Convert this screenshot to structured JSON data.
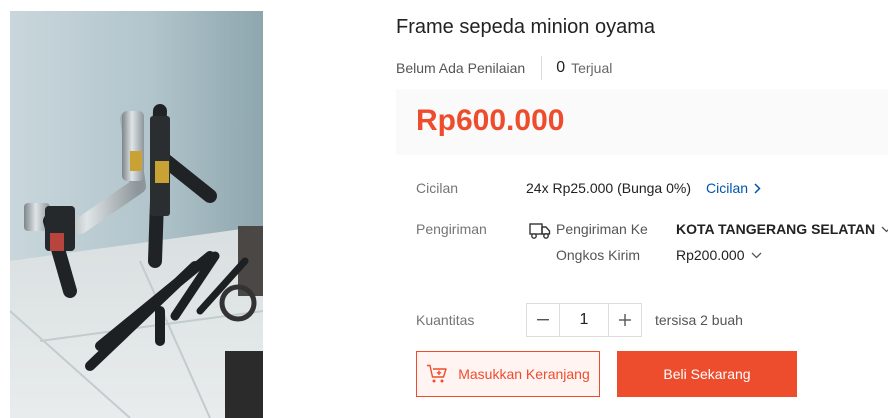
{
  "product": {
    "title": "Frame sepeda minion oyama",
    "rating_text": "Belum Ada Penilaian",
    "sold_count": "0",
    "sold_label": "Terjual",
    "price": "Rp600.000",
    "image_icon": "bicycle-frame-photo"
  },
  "installment": {
    "label": "Cicilan",
    "detail": "24x Rp25.000 (Bunga 0%)",
    "link": "Cicilan"
  },
  "shipping": {
    "label": "Pengiriman",
    "to_label": "Pengiriman Ke",
    "destination": "KOTA TANGERANG SELATAN",
    "cost_label": "Ongkos Kirim",
    "cost": "Rp200.000",
    "icon": "truck-icon"
  },
  "quantity": {
    "label": "Kuantitas",
    "value": "1",
    "stock": "tersisa 2 buah"
  },
  "actions": {
    "add_to_cart": "Masukkan Keranjang",
    "buy_now": "Beli Sekarang"
  },
  "colors": {
    "brand": "#ee4d2d",
    "link": "#0055aa"
  }
}
